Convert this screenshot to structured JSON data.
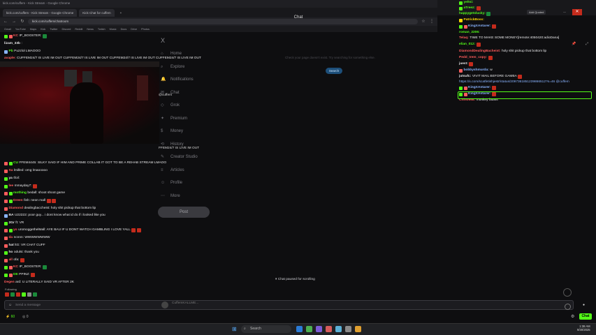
{
  "browser": {
    "tab_active": "kick.com/cuffem - Kick Stream - Google Chrome",
    "tab_second": "Kick Chat for cuffem",
    "url": "kick.com/cuffem/chatroom",
    "bookmarks": [
      "Gmail",
      "YouTube",
      "Maps",
      "Kick",
      "Twitter",
      "Discord",
      "Reddit",
      "News",
      "Twitch",
      "Music",
      "Docs",
      "Drive",
      "Photos"
    ],
    "chat_window_title": "Chat"
  },
  "x_sidebar": {
    "logo": "X",
    "items": [
      "Home",
      "Explore",
      "Notifications",
      "Chat",
      "Grok",
      "Premium",
      "Money",
      "History",
      "Creator Studio",
      "Articles",
      "Profile",
      "More"
    ],
    "post_label": "Post",
    "search_hint": "Check your page doesn't exist. Try searching for something else.",
    "search_button": "Search"
  },
  "left_chat": {
    "lines": [
      {
        "user": "KC",
        "user_color": "#ff5c5c",
        "text": "IP_BOOSTER:",
        "badges": [
          "#53fc18",
          "#ff5c5c"
        ],
        "emotes": [
          "#1a8a3a"
        ]
      },
      {
        "user": "lizam_33b",
        "user_color": "#e8e8ea",
        "text": ":",
        "badges": [],
        "emotes": []
      },
      {
        "user": "Pb",
        "user_color": "#53fc18",
        "text": "Puzzlol LMAOOO",
        "badges": [
          "#8ab4ff"
        ],
        "emotes": []
      },
      {
        "user": "avaple:",
        "user_color": "#ff5c5c",
        "text": "CUFFEM24/7 IS LIVE IM OUT CUFFEM24/7 IS LIVE IM OUT CUFFEM24/7 IS LIVE IM OUT CUFFEM24/7 IS LIVE IM OUT",
        "badges": [],
        "emotes": []
      },
      {
        "user": "CU",
        "user_color": "#53fc18",
        "text": "FFEM4445: SILKY SAID IF HIM AND PRIME COLLAB IT GOT TO BE A REHAB STREAM LMAOO",
        "badges": [
          "#ff5c5c",
          "#53fc18"
        ],
        "emotes": []
      },
      {
        "user": "Sa",
        "user_color": "#ff5c5c",
        "text": "lmilled: omg lmaooooo",
        "badges": [
          "#ff5c5c"
        ],
        "emotes": []
      },
      {
        "user": "ya",
        "user_color": "#e8e8ea",
        "text": "tfoil:",
        "badges": [
          "#53fc18"
        ],
        "emotes": []
      },
      {
        "user": "lee",
        "user_color": "#ff5c5c",
        "text": "mmayday7:",
        "badges": [
          "#53fc18"
        ],
        "emotes": [
          "#c42b1c"
        ]
      },
      {
        "user": "mothing",
        "user_color": "#53fc18",
        "text": "bedall: shoot shoot game",
        "badges": [
          "#ff5c5c",
          "#53fc18"
        ],
        "emotes": []
      },
      {
        "user": "Dreen",
        "user_color": "#ff5c5c",
        "text": "fish: neon mall",
        "badges": [
          "#ff5c5c",
          "#53fc18"
        ],
        "emotes": [
          "#c42b1c",
          "#c42b1c"
        ]
      },
      {
        "user": "Diamond",
        "user_color": "#ff5c5c",
        "text": "dealingbaccheist: holy shit pickup that bottom lip",
        "badges": [
          "#ff5c5c"
        ],
        "emotes": []
      },
      {
        "user": "BA",
        "user_color": "#e8e8ea",
        "text": "U22222: poor guy... i dont know what id do if i looked like you",
        "badges": [
          "#8ab4ff"
        ],
        "emotes": []
      },
      {
        "user": "2Gr",
        "user_color": "#e8e8ea",
        "text": "ft: VR",
        "badges": [
          "#53fc18"
        ],
        "emotes": []
      },
      {
        "user": "yo",
        "user_color": "#ff5c5c",
        "text": "uromoggethelMall: AYE BAU IF U DONT WATCH GAMBLING I LOVE YALL",
        "badges": [
          "#ff5c5c",
          "#53fc18"
        ],
        "emotes": [
          "#c42b1c",
          "#c42b1c"
        ]
      },
      {
        "user": "da",
        "user_color": "#ff5c5c",
        "text": "ncnnn: WWWWWWWW",
        "badges": [
          "#ff5c5c"
        ],
        "emotes": []
      },
      {
        "user": "hat",
        "user_color": "#e8e8ea",
        "text": "ltG: VR CHAT CUFF",
        "badges": [
          "#ff5c5c"
        ],
        "emotes": []
      },
      {
        "user": "ho",
        "user_color": "#e8e8ea",
        "text": "odulsi: thank you",
        "badges": [
          "#53fc18"
        ],
        "emotes": []
      },
      {
        "user": "all",
        "user_color": "#ff5c5c",
        "text": "ofa:",
        "badges": [
          "#ff5c5c"
        ],
        "emotes": [
          "#c42b1c"
        ]
      },
      {
        "user": "KC",
        "user_color": "#ff5c5c",
        "text": "IP_BOOSTER:",
        "badges": [
          "#53fc18",
          "#ff5c5c"
        ],
        "emotes": [
          "#1a8a3a"
        ]
      },
      {
        "user": "DE",
        "user_color": "#53fc18",
        "text": "PPINZ:",
        "badges": [
          "#53fc18",
          "#ff5c5c"
        ],
        "emotes": [
          "#c42b1c"
        ]
      },
      {
        "user": "Degen",
        "user_color": "#ff5c5c",
        "text": "ard: U LITERALLY SAID VR AFTER 2K",
        "badges": [],
        "emotes": []
      }
    ],
    "midscreen_text": "@cuffem",
    "midscreen_text2": "FFEM24/7 IS LIVE IM OUT",
    "following": "Following",
    "paused": "Chat paused for scrolling",
    "input_placeholder": "Send a message",
    "input_user": "CuffemKALLME...",
    "viewers": "60",
    "points": "0",
    "chat_button": "Chat"
  },
  "right_chat": {
    "lines": [
      {
        "user": "yeltsi:",
        "user_color": "#53fc18",
        "text": "",
        "badges": [
          "#53fc18"
        ],
        "emotes": []
      },
      {
        "user": "aTreez:",
        "user_color": "#53fc18",
        "text": "",
        "badges": [
          "#53fc18"
        ],
        "emotes": [
          "#c42b1c"
        ]
      },
      {
        "user": "happygetslucky:",
        "user_color": "#53fc18",
        "text": "",
        "badges": [],
        "emotes": [
          "#1a8a3a"
        ]
      },
      {
        "user": "PatrickBoss:",
        "user_color": "#ffd700",
        "text": "",
        "badges": [
          "#ffd700"
        ],
        "emotes": []
      },
      {
        "user": "KingXAntarer:",
        "user_color": "#8ab4ff",
        "text": "",
        "badges": [
          "#53fc18",
          "#ff5c5c"
        ],
        "emotes": [
          "#c42b1c"
        ]
      },
      {
        "user": "roman_2206:",
        "user_color": "#53fc18",
        "text": "",
        "badges": [],
        "emotes": []
      },
      {
        "user": "Telaq:",
        "user_color": "#ff5c5c",
        "text": "TIME TO MAKE SOME MONEY[remote:4050420:adioDana]",
        "badges": [],
        "emotes": []
      },
      {
        "user": "elian_012:",
        "user_color": "#53fc18",
        "text": "",
        "badges": [],
        "emotes": [
          "#c42b1c"
        ]
      },
      {
        "user": "DiamondDealingBacheist:",
        "user_color": "#ff5c5c",
        "text": "holy shit pickup that bottom lip",
        "badges": [],
        "emotes": []
      },
      {
        "user": "Pedd_Irem_copy:",
        "user_color": "#ff5c5c",
        "text": "",
        "badges": [],
        "emotes": [
          "#c42b1c"
        ]
      },
      {
        "user": "juest:",
        "user_color": "#e8e8ea",
        "text": "",
        "badges": [],
        "emotes": [
          "#c42b1c"
        ]
      },
      {
        "user": "bobbyshmurda:",
        "user_color": "#8ab4ff",
        "text": "w",
        "badges": [
          "#ff5c5c"
        ],
        "emotes": []
      },
      {
        "user": "jutsufc:",
        "user_color": "#e8e8ea",
        "text": "VIVIT MAIL BEFORE GAMBA",
        "badges": [],
        "emotes": [
          "#c42b1c"
        ]
      },
      {
        "user": "",
        "user_color": "#e8e8ea",
        "text": "https://x.com/scatfetishjestr/status/2097361851239866512?s=46 @cuffem",
        "badges": [],
        "emotes": []
      },
      {
        "user": "KingXAntarer:",
        "user_color": "#8ab4ff",
        "text": "",
        "badges": [
          "#53fc18",
          "#ff5c5c"
        ],
        "emotes": [
          "#c42b1c"
        ]
      },
      {
        "user": "KingXAntarer:",
        "user_color": "#8ab4ff",
        "text": "",
        "badges": [
          "#53fc18",
          "#ff5c5c"
        ],
        "emotes": [
          "#c42b1c"
        ]
      },
      {
        "user": "Chino998:",
        "user_color": "#ff5c5c",
        "text": "monkey fatass",
        "badges": [],
        "emotes": []
      }
    ],
    "window_label": "Add Quoted",
    "close": "✕"
  },
  "taskbar": {
    "search_label": "Search",
    "time": "1:38 AM",
    "date": "9/30/2025"
  }
}
